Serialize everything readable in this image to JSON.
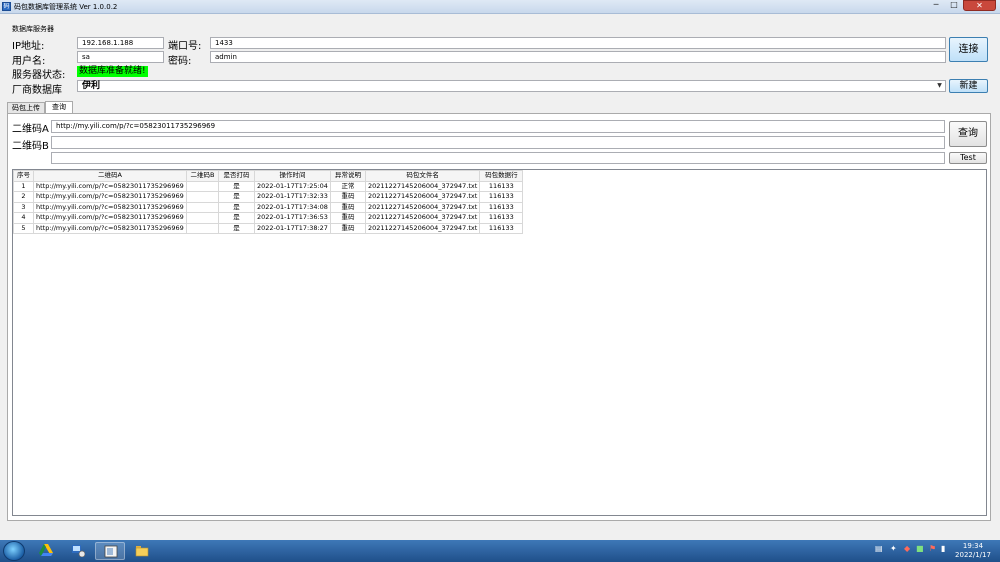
{
  "window": {
    "title": "码包数据库管理系统 Ver 1.0.0.2",
    "min_label": "─",
    "max_label": "□",
    "close_label": "✕"
  },
  "server": {
    "group_title": "数据库服务器",
    "ip_label": "IP地址:",
    "ip_value": "192.168.1.188",
    "port_label": "端口号:",
    "port_value": "1433",
    "user_label": "用户名:",
    "user_value": "sa",
    "password_label": "密码:",
    "password_value": "admin",
    "status_label": "服务器状态:",
    "status_value": "数据库准备就绪!",
    "status_color": "#00ff00",
    "connect_button": "连接",
    "vendor_label": "厂商数据库",
    "vendor_value": "伊利",
    "new_button": "新建"
  },
  "tabs": [
    {
      "label": "码包上传",
      "active": false
    },
    {
      "label": "查询",
      "active": true
    }
  ],
  "query": {
    "qr_a_label": "二维码A",
    "qr_a_value": "http://my.yili.com/p/?c=05823011735296969",
    "qr_b_label": "二维码B",
    "qr_b_value": "",
    "extra_value": "",
    "query_button": "查询",
    "test_button": "Test"
  },
  "table": {
    "columns": [
      "序号",
      "二维码A",
      "二维码B",
      "是否打码",
      "操作时间",
      "异常说明",
      "码包文件名",
      "码包数据行"
    ],
    "rows": [
      [
        "1",
        "http://my.yili.com/p/?c=05823011735296969",
        "",
        "是",
        "2022-01-17T17:25:04",
        "正常",
        "20211227145206004_372947.txt",
        "116133"
      ],
      [
        "2",
        "http://my.yili.com/p/?c=05823011735296969",
        "",
        "是",
        "2022-01-17T17:32:33",
        "重码",
        "20211227145206004_372947.txt",
        "116133"
      ],
      [
        "3",
        "http://my.yili.com/p/?c=05823011735296969",
        "",
        "是",
        "2022-01-17T17:34:08",
        "重码",
        "20211227145206004_372947.txt",
        "116133"
      ],
      [
        "4",
        "http://my.yili.com/p/?c=05823011735296969",
        "",
        "是",
        "2022-01-17T17:36:53",
        "重码",
        "20211227145206004_372947.txt",
        "116133"
      ],
      [
        "5",
        "http://my.yili.com/p/?c=05823011735296969",
        "",
        "是",
        "2022-01-17T17:38:27",
        "重码",
        "20211227145206004_372947.txt",
        "116133"
      ]
    ]
  },
  "taskbar": {
    "apps": [
      "start-orb-icon",
      "google-drive-icon",
      "network-app-icon",
      "window-app-icon",
      "folder-icon"
    ],
    "time": "19:34",
    "date": "2022/1/17"
  }
}
